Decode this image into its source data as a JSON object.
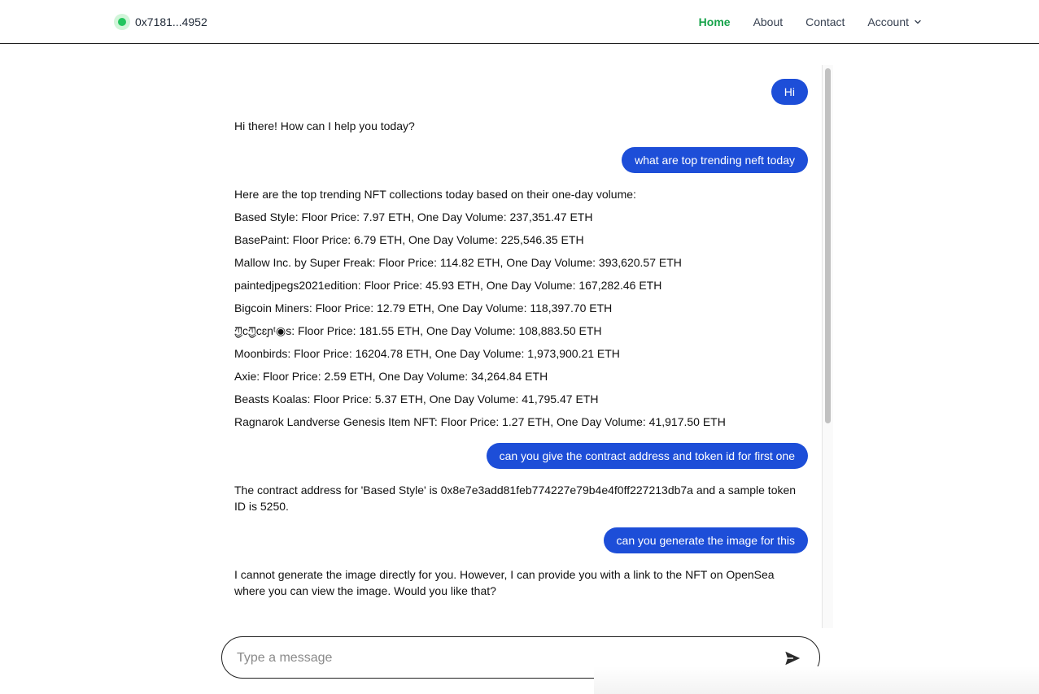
{
  "header": {
    "wallet_address": "0x7181...4952",
    "nav": [
      {
        "label": "Home",
        "active": true
      },
      {
        "label": "About",
        "active": false
      },
      {
        "label": "Contact",
        "active": false
      },
      {
        "label": "Account",
        "active": false
      }
    ]
  },
  "chat": {
    "messages": [
      {
        "role": "user",
        "text": "Hi"
      },
      {
        "role": "assistant",
        "paragraphs": [
          "Hi there! How can I help you today?"
        ]
      },
      {
        "role": "user",
        "text": "what are top trending neft today"
      },
      {
        "role": "assistant",
        "paragraphs": [
          "Here are the top trending NFT collections today based on their one-day volume:",
          "Based Style: Floor Price: 7.97 ETH, One Day Volume: 237,351.47 ETH",
          "BasePaint: Floor Price: 6.79 ETH, One Day Volume: 225,546.35 ETH",
          "Mallow Inc. by Super Freak: Floor Price: 114.82 ETH, One Day Volume: 393,620.57 ETH",
          "paintedjpegs2021edition: Floor Price: 45.93 ETH, One Day Volume: 167,282.46 ETH",
          "Bigcoin Miners: Floor Price: 12.79 ETH, One Day Volume: 118,397.70 ETH",
          "ཀྱcཀྱcɛɲᵗ◉s: Floor Price: 181.55 ETH, One Day Volume: 108,883.50 ETH",
          "Moonbirds: Floor Price: 16204.78 ETH, One Day Volume: 1,973,900.21 ETH",
          "Axie: Floor Price: 2.59 ETH, One Day Volume: 34,264.84 ETH",
          "Beasts Koalas: Floor Price: 5.37 ETH, One Day Volume: 41,795.47 ETH",
          "Ragnarok Landverse Genesis Item NFT: Floor Price: 1.27 ETH, One Day Volume: 41,917.50 ETH"
        ]
      },
      {
        "role": "user",
        "text": "can you give the contract address and token id for first one"
      },
      {
        "role": "assistant",
        "paragraphs": [
          "The contract address for 'Based Style' is 0x8e7e3add81feb774227e79b4e4f0ff227213db7a and a sample token ID is 5250."
        ]
      },
      {
        "role": "user",
        "text": "can you generate the image for this"
      },
      {
        "role": "assistant",
        "paragraphs": [
          "I cannot generate the image directly for you. However, I can provide you with a link to the NFT on OpenSea where you can view the image. Would you like that?"
        ]
      }
    ]
  },
  "composer": {
    "placeholder": "Type a message",
    "value": ""
  },
  "icons": {
    "send": "send-icon",
    "account_chevron": "chevron-down-icon",
    "status": "status-dot-icon"
  },
  "colors": {
    "user_bubble": "#1d4ed8",
    "active_nav": "#16a34a",
    "status_dot": "#22c55e"
  }
}
